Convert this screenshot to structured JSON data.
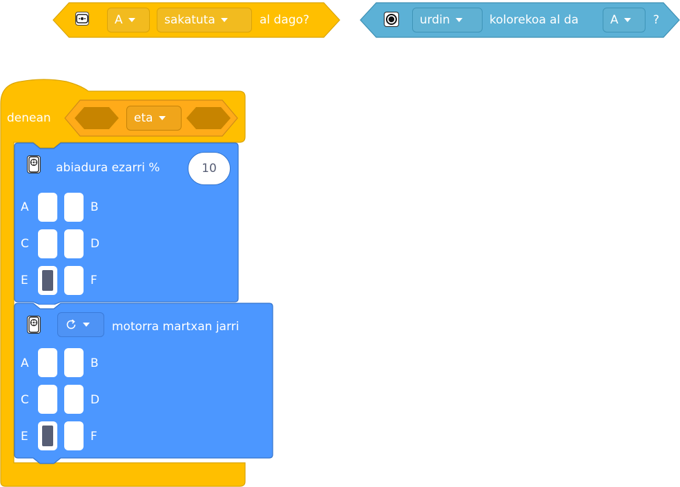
{
  "touch_block": {
    "sensor_icon": "touch-sensor-icon",
    "port": "A",
    "state": "sakatuta",
    "suffix": "al dago?",
    "color": "#ffbf00"
  },
  "color_block": {
    "sensor_icon": "color-sensor-icon",
    "color_value": "urdin",
    "middle": "kolorekoa al da",
    "port": "A",
    "suffix": "?",
    "color": "#5cb1d6"
  },
  "when_block": {
    "label": "denean",
    "operator": "eta",
    "color": "#ffbf00"
  },
  "speed_block": {
    "icon": "motor-icon",
    "label": "abiadura ezarri %",
    "value": "10",
    "ports": [
      {
        "left": "A",
        "right": "B",
        "left_on": false,
        "right_on": false
      },
      {
        "left": "C",
        "right": "D",
        "left_on": false,
        "right_on": false
      },
      {
        "left": "E",
        "right": "F",
        "left_on": true,
        "right_on": false
      }
    ],
    "color": "#4c97ff"
  },
  "start_block": {
    "icon": "motor-icon",
    "direction_icon": "rotate-clockwise-icon",
    "label": "motorra martxan jarri",
    "ports": [
      {
        "left": "A",
        "right": "B",
        "left_on": false,
        "right_on": false
      },
      {
        "left": "C",
        "right": "D",
        "left_on": false,
        "right_on": false
      },
      {
        "left": "E",
        "right": "F",
        "left_on": true,
        "right_on": false
      }
    ],
    "color": "#4c97ff"
  }
}
